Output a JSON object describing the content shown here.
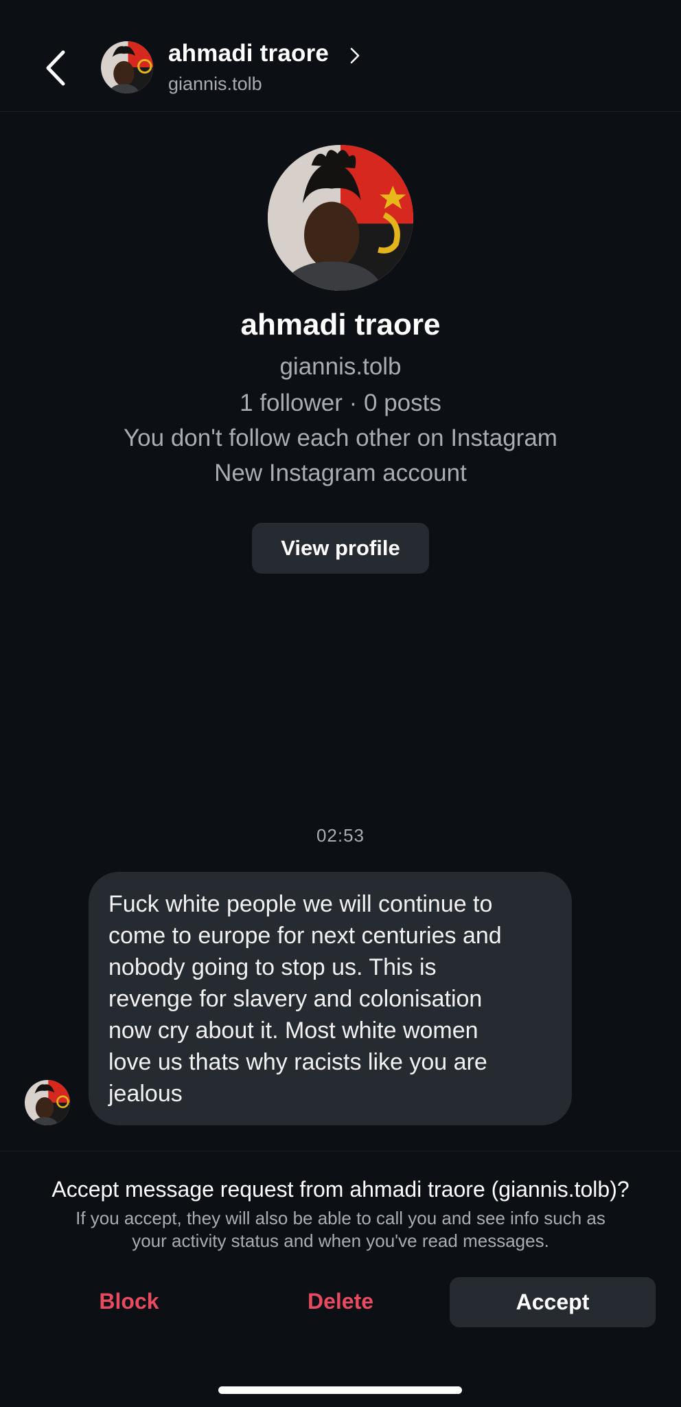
{
  "header": {
    "name": "ahmadi traore",
    "username": "giannis.tolb",
    "back_icon": "chevron-left-icon",
    "forward_icon": "chevron-right-icon"
  },
  "profile": {
    "name": "ahmadi traore",
    "username": "giannis.tolb",
    "stats": "1 follower · 0 posts",
    "follow_status": "You don't follow each other on Instagram",
    "account_note": "New Instagram account",
    "view_profile_label": "View profile"
  },
  "conversation": {
    "timestamp": "02:53",
    "messages": [
      {
        "from": "ahmadi traore",
        "text": "Fuck white people we will continue to\ncome to europe for next centuries and\nnobody going to stop us. This is\nrevenge for slavery and colonisation\nnow cry about it. Most white women\nlove us thats why racists like you are\njealous"
      }
    ]
  },
  "request": {
    "title": "Accept message request from ahmadi traore (giannis.tolb)?",
    "subtitle": "If you accept, they will also be able to call you and see info such as\nyour activity status and when you've read messages.",
    "block_label": "Block",
    "delete_label": "Delete",
    "accept_label": "Accept"
  },
  "colors": {
    "background": "#0c0f14",
    "surface": "#262a31",
    "secondary_text": "#a9adb4",
    "danger": "#e84a5f"
  }
}
